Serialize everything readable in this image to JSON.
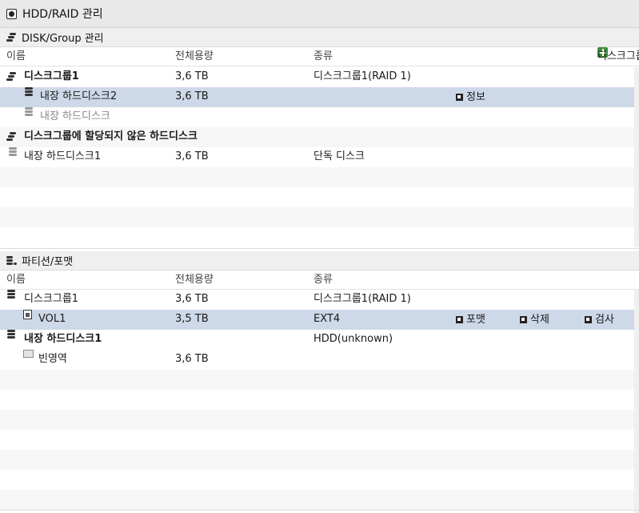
{
  "window": {
    "title": "HDD/RAID 관리"
  },
  "disk_group": {
    "section_title": "DISK/Group 관리",
    "columns": {
      "name": "이름",
      "capacity": "전체용량",
      "type": "종류"
    },
    "create_button": "디스크그룹 생성",
    "rows": [
      {
        "name": "디스크그룹1",
        "capacity": "3,6 TB",
        "type": "디스크그룹1(RAID 1)"
      },
      {
        "name": "내장 하드디스크2",
        "capacity": "3,6 TB",
        "type": "",
        "action": "정보"
      },
      {
        "name": "내장 하드디스크",
        "capacity": "",
        "type": ""
      },
      {
        "name": "디스크그룹에 할당되지 않은 하드디스크",
        "capacity": "",
        "type": ""
      },
      {
        "name": "내장 하드디스크1",
        "capacity": "3,6 TB",
        "type": "단독 디스크"
      }
    ]
  },
  "partition": {
    "section_title": "파티션/포맷",
    "columns": {
      "name": "이름",
      "capacity": "전체용량",
      "type": "종류"
    },
    "rows": [
      {
        "name": "디스크그룹1",
        "capacity": "3,6 TB",
        "type": "디스크그룹1(RAID 1)"
      },
      {
        "name": "VOL1",
        "capacity": "3,5 TB",
        "type": "EXT4",
        "actions": [
          "포맷",
          "삭제",
          "검사"
        ]
      },
      {
        "name": "내장 하드디스크1",
        "capacity": "",
        "type": "HDD(unknown)"
      },
      {
        "name": "빈영역",
        "capacity": "3,6 TB",
        "type": ""
      }
    ]
  }
}
